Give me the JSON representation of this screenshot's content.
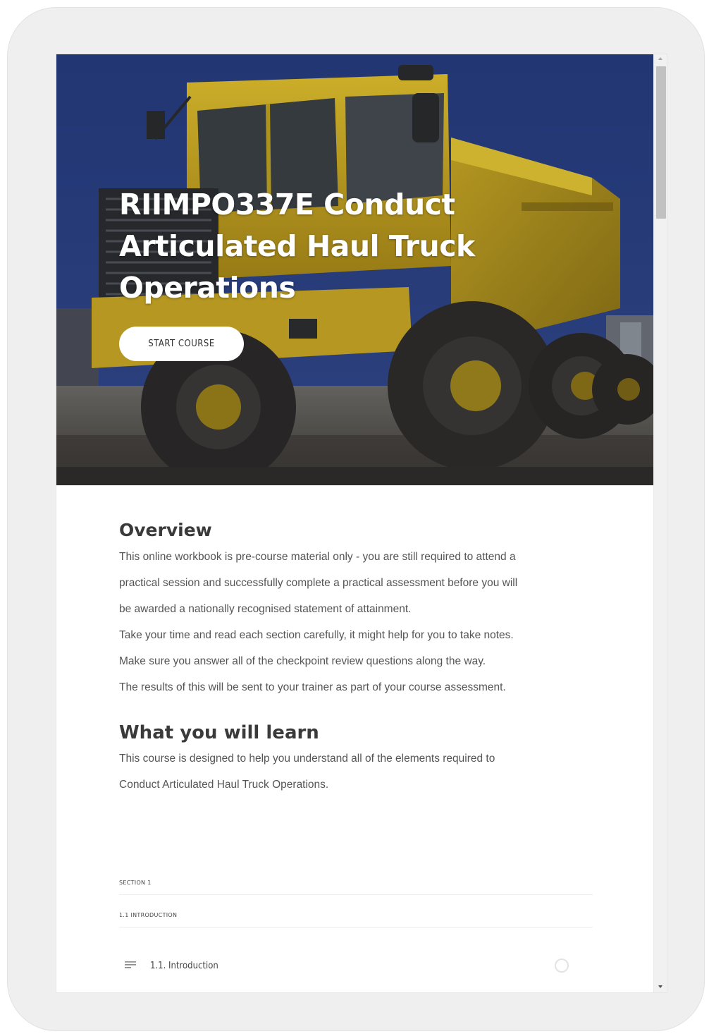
{
  "course": {
    "title_line1": "RIIMPO337E Conduct",
    "title_line2": "Articulated Haul Truck",
    "title_line3": "Operations",
    "start_button": "START COURSE"
  },
  "overview": {
    "heading": "Overview",
    "lines": [
      "This online workbook is pre-course material only - you are still required to attend a",
      "practical session and successfully complete a practical assessment before you will",
      "be awarded a nationally recognised statement of attainment.",
      "Take your time and read each section carefully, it might help for you to take notes.",
      "Make sure you answer all of the checkpoint review questions along the way.",
      "The results of this will be sent to your trainer as part of your course assessment."
    ]
  },
  "learn": {
    "heading": "What you will learn",
    "lines": [
      "This course is designed to help you understand all of the elements required to",
      "Conduct Articulated Haul Truck Operations."
    ]
  },
  "outline": {
    "section_label": "SECTION 1",
    "subsection_label": "1.1 INTRODUCTION",
    "lesson_label": "1.1. Introduction",
    "lesson_icon": "text-lines-icon",
    "status_icon": "incomplete-circle-icon"
  },
  "colors": {
    "hero_sky": "#2b3f7e",
    "truck_yellow": "#d4b019",
    "heading_text": "#3a3a3a",
    "body_text": "#555555"
  }
}
